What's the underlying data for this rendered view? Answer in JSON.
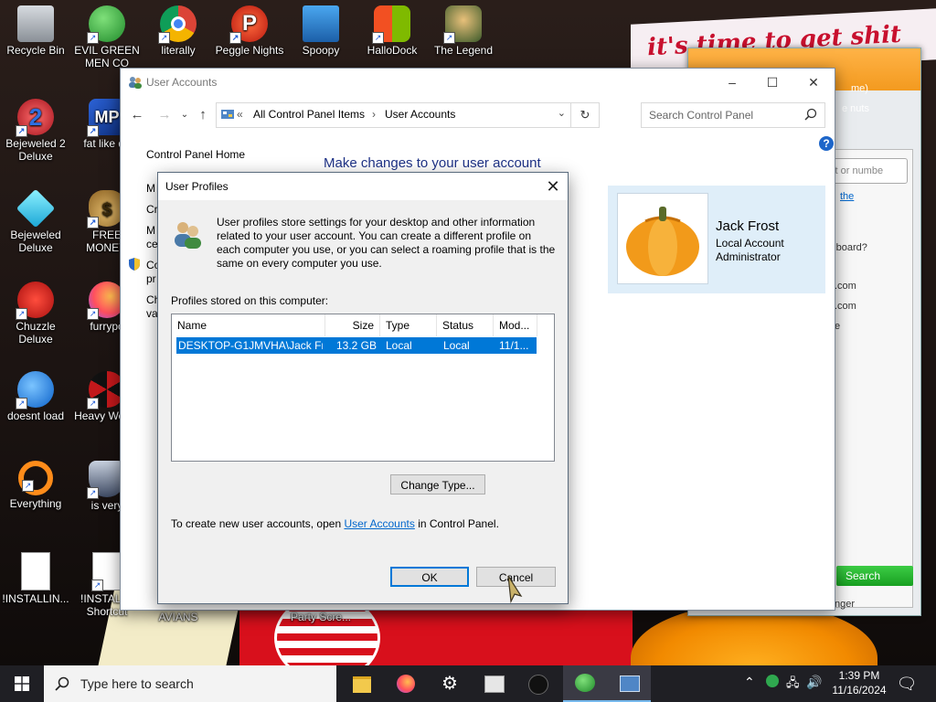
{
  "wallpaper": {
    "banner_text": "it's time to get shit"
  },
  "desktop_icons": [
    {
      "label": "Recycle Bin",
      "icon": "recycle-bin-icon"
    },
    {
      "label": "EVIL GREEN MEN CO",
      "icon": "green-men-icon"
    },
    {
      "label": "literally",
      "icon": "chrome-icon"
    },
    {
      "label": "Peggle Nights",
      "icon": "peggle-icon"
    },
    {
      "label": "Spoopy",
      "icon": "computers-icon"
    },
    {
      "label": "HalloDock",
      "icon": "hallodock-icon"
    },
    {
      "label": "The Legend",
      "icon": "legend-icon"
    },
    {
      "label": "Bejeweled 2 Deluxe",
      "icon": "bejeweled2-icon"
    },
    {
      "label": "fat like da",
      "icon": "game-icon"
    },
    {
      "label": "Bejeweled Deluxe",
      "icon": "bejeweled-icon"
    },
    {
      "label": "FREE MONEY.",
      "icon": "money-bag-icon"
    },
    {
      "label": "Chuzzle Deluxe",
      "icon": "chuzzle-icon"
    },
    {
      "label": "furrypo",
      "icon": "firefox-icon"
    },
    {
      "label": "doesnt load",
      "icon": "thunderbird-icon"
    },
    {
      "label": "Heavy Weap.",
      "icon": "radiation-icon"
    },
    {
      "label": "Everything",
      "icon": "everything-search-icon"
    },
    {
      "label": "is very",
      "icon": "shield-game-icon"
    },
    {
      "label": "!INSTALLIN...",
      "icon": "document-icon"
    },
    {
      "label": "!INSTALL - Shortcut",
      "icon": "document-shortcut-icon"
    },
    {
      "label": "AVIANS",
      "icon": "folder-icon"
    },
    {
      "label": "Party Scre...",
      "icon": "game-icon"
    }
  ],
  "im_window": {
    "line1": "me)",
    "line2": "e nuts",
    "input_placeholder": "ct or numbe",
    "link_text": "the",
    "lines": [
      "chboard?",
      ".com",
      ".com",
      "e"
    ],
    "search_button": "Search",
    "footer": "nger"
  },
  "control_panel": {
    "title": "User Accounts",
    "address": {
      "root": "All Control Panel Items",
      "current": "User Accounts"
    },
    "search_placeholder": "Search Control Panel",
    "left_home": "Control Panel Home",
    "left_fragments": [
      "M",
      "Cr",
      "M",
      "ce",
      "Co",
      "pr",
      "Ch",
      "va"
    ],
    "heading": "Make changes to your user account",
    "user": {
      "name": "Jack Frost",
      "type": "Local Account",
      "role": "Administrator"
    }
  },
  "dialog": {
    "title": "User Profiles",
    "description": "User profiles store settings for your desktop and other information related to your user account. You can create a different profile on each computer you use, or you can select a roaming profile that is the same on every computer you use.",
    "profiles_label": "Profiles stored on this computer:",
    "columns": [
      "Name",
      "Size",
      "Type",
      "Status",
      "Mod..."
    ],
    "rows": [
      {
        "name": "DESKTOP-G1JMVHA\\Jack Fr...",
        "size": "13.2 GB",
        "type": "Local",
        "status": "Local",
        "modified": "11/1..."
      }
    ],
    "change_type_button": "Change Type...",
    "footer_prefix": "To create new user accounts, open",
    "footer_link": "User Accounts",
    "footer_suffix": "in Control Panel.",
    "ok_button": "OK",
    "cancel_button": "Cancel"
  },
  "taskbar": {
    "search_placeholder": "Type here to search",
    "time": "1:39 PM",
    "date": "11/16/2024"
  }
}
